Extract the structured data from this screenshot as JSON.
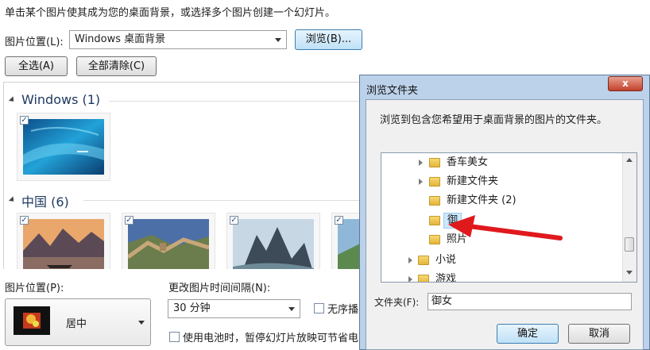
{
  "instruction": "单击某个图片使其成为您的桌面背景，或选择多个图片创建一个幻灯片。",
  "location": {
    "label": "图片位置(L):",
    "value": "Windows 桌面背景",
    "browse_label": "浏览(B)..."
  },
  "buttons": {
    "select_all": "全选(A)",
    "clear_all": "全部清除(C)"
  },
  "groups": [
    {
      "title": "Windows (1)"
    },
    {
      "title": "中国 (6)"
    }
  ],
  "checkmark": "✓",
  "bottom": {
    "position_label": "图片位置(P):",
    "position_value": "居中",
    "interval_label": "更改图片时间间隔(N):",
    "interval_value": "30 分钟",
    "shuffle_label": "无序播",
    "battery_label": "使用电池时，暂停幻灯片放映可节省电"
  },
  "dialog": {
    "title": "浏览文件夹",
    "close_label": "x",
    "prompt": "浏览到包含您希望用于桌面背景的图片的文件夹。",
    "tree": [
      {
        "label": "香车美女",
        "expandable": true
      },
      {
        "label": "新建文件夹",
        "expandable": true
      },
      {
        "label": "新建文件夹 (2)",
        "expandable": false
      },
      {
        "label": "御",
        "expandable": false,
        "selected": true
      },
      {
        "label": "照片",
        "expandable": false
      },
      {
        "label": "小说",
        "expandable": true
      },
      {
        "label": "游戏",
        "expandable": true
      }
    ],
    "folder_label": "文件夹(F):",
    "folder_value": "御女",
    "ok_label": "确定",
    "cancel_label": "取消"
  },
  "colors": {
    "annotation_arrow": "#e0191d",
    "selection": "#cde8ff"
  }
}
